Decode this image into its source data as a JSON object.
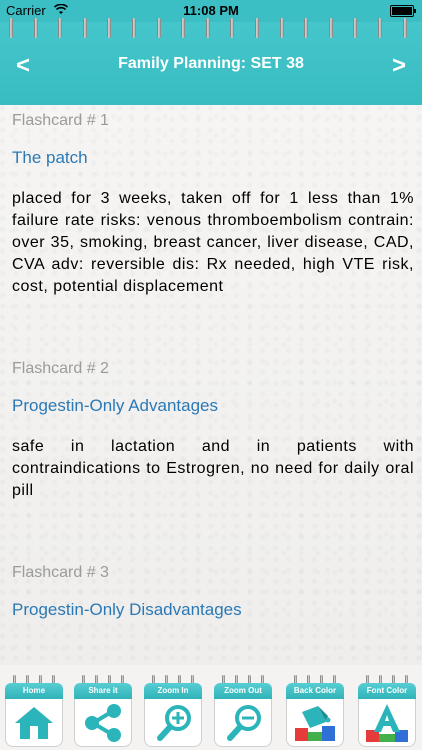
{
  "status_bar": {
    "carrier": "Carrier",
    "time": "11:08 PM"
  },
  "header": {
    "title": "Family Planning: SET 38",
    "back_icon": "chevron-left-icon",
    "forward_icon": "chevron-right-icon",
    "back_glyph": "<",
    "forward_glyph": ">"
  },
  "cards": [
    {
      "number": "Flashcard # 1",
      "title": "The patch",
      "body": "placed for 3 weeks, taken off for 1 less than 1% failure rate risks: venous thromboembolism contrain: over 35, smoking, breast cancer, liver disease, CAD, CVA adv: reversible dis: Rx needed, high VTE risk, cost, potential displacement"
    },
    {
      "number": "Flashcard # 2",
      "title": "Progestin-Only Advantages",
      "body": "safe in lactation and in patients with contraindications to Estrogren, no need for daily oral pill"
    },
    {
      "number": "Flashcard # 3",
      "title": "Progestin-Only Disadvantages",
      "body": ""
    }
  ],
  "toolbar": {
    "items": [
      {
        "label": "Home",
        "icon": "home-icon"
      },
      {
        "label": "Share it",
        "icon": "share-icon"
      },
      {
        "label": "Zoom In",
        "icon": "zoom-in-icon"
      },
      {
        "label": "Zoom Out",
        "icon": "zoom-out-icon"
      },
      {
        "label": "Back Color",
        "icon": "paint-bucket-icon"
      },
      {
        "label": "Font Color",
        "icon": "font-color-icon"
      }
    ]
  },
  "colors": {
    "accent": "#3bbfc4",
    "card_title": "#2a79b6",
    "card_number": "#9b9b9b"
  }
}
